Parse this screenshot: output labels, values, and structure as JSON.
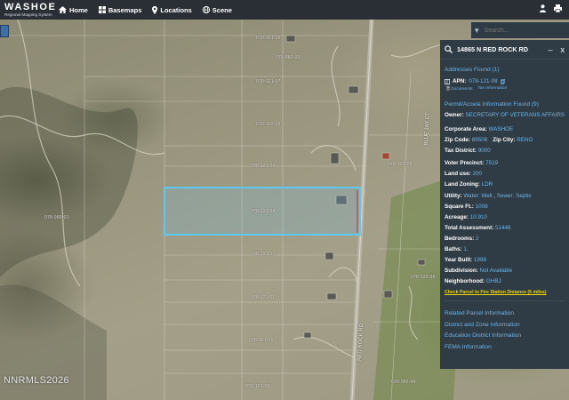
{
  "brand": {
    "name": "WASHOE",
    "subtitle": "Regional Mapping System"
  },
  "nav": [
    {
      "label": "Home",
      "icon": "home-icon"
    },
    {
      "label": "Basemaps",
      "icon": "basemaps-icon"
    },
    {
      "label": "Locations",
      "icon": "location-pin-icon"
    },
    {
      "label": "Scene",
      "icon": "globe-icon"
    }
  ],
  "top_icons": [
    "user-icon",
    "printer-icon"
  ],
  "search": {
    "placeholder": "Search..."
  },
  "watermark": "NNRMLS2026",
  "map_labels": {
    "road_main": "RED ROCK RD",
    "road_side": "BLUE JAY CT",
    "parcels": [
      "078-121-06",
      "078-121-07",
      "078-121-08",
      "078-121-05",
      "078-122-06",
      "078-122-05",
      "078-121-12",
      "078-121-11",
      "078-121-10",
      "078-082-01",
      "078-080-01",
      "078-121-09",
      "078-082-04"
    ]
  },
  "panel": {
    "title": "14865 N RED ROCK RD",
    "minimize": "–",
    "close": "x",
    "addresses_found": "Addresses Found (1)",
    "apn_label": "APN:",
    "apn_value": "078-121-08",
    "documents": "Documents",
    "tax_info": "Tax Information",
    "permit_info": "Permit/Accela Information Found (9)",
    "owner_label": "Owner:",
    "owner_value": "SECRETARY OF VETERANS AFFAIRS",
    "corp_label": "Corporate Area:",
    "corp_value": "WASHOE",
    "zip_label": "Zip Code:",
    "zip_value": "89508",
    "city_label": "Zip City:",
    "city_value": "RENO",
    "tax_district_label": "Tax District:",
    "tax_district_value": "9000",
    "voter_label": "Voter Precinct:",
    "voter_value": "7519",
    "land_use_label": "Land use:",
    "land_use_value": "200",
    "zoning_label": "Land Zoning:",
    "zoning_value": "LDR",
    "utility_label": "Utility:",
    "water_label": "Water:",
    "water_value": "Well",
    "sewer_label": "Sewer:",
    "sewer_value": "Septic",
    "sqft_label": "Square Ft.:",
    "sqft_value": "1008",
    "acreage_label": "Acreage:",
    "acreage_value": "10.910",
    "assessment_label": "Total Assessment:",
    "assessment_value": "51446",
    "bedrooms_label": "Bedrooms:",
    "bedrooms_value": "2",
    "baths_label": "Baths:",
    "baths_value": "1.",
    "year_label": "Year Built:",
    "year_value": "1998",
    "subdivision_label": "Subdivision:",
    "subdivision_value": "Not Available",
    "neighborhood_label": "Neighborhood:",
    "neighborhood_value": "GHBJ",
    "fire_link": "Check Parcel to Fire Station Distance (5 miles)",
    "bottom_links": [
      "Related Parcel Information",
      "District and Zone Information",
      "Education District Information",
      "FEMA Information"
    ]
  },
  "colors": {
    "topbar": "#2a2f36",
    "panel": "#2f3b45",
    "link": "#6fb6e8",
    "highlight": "#f0d800",
    "parcel_outline": "#5ec8f0"
  }
}
